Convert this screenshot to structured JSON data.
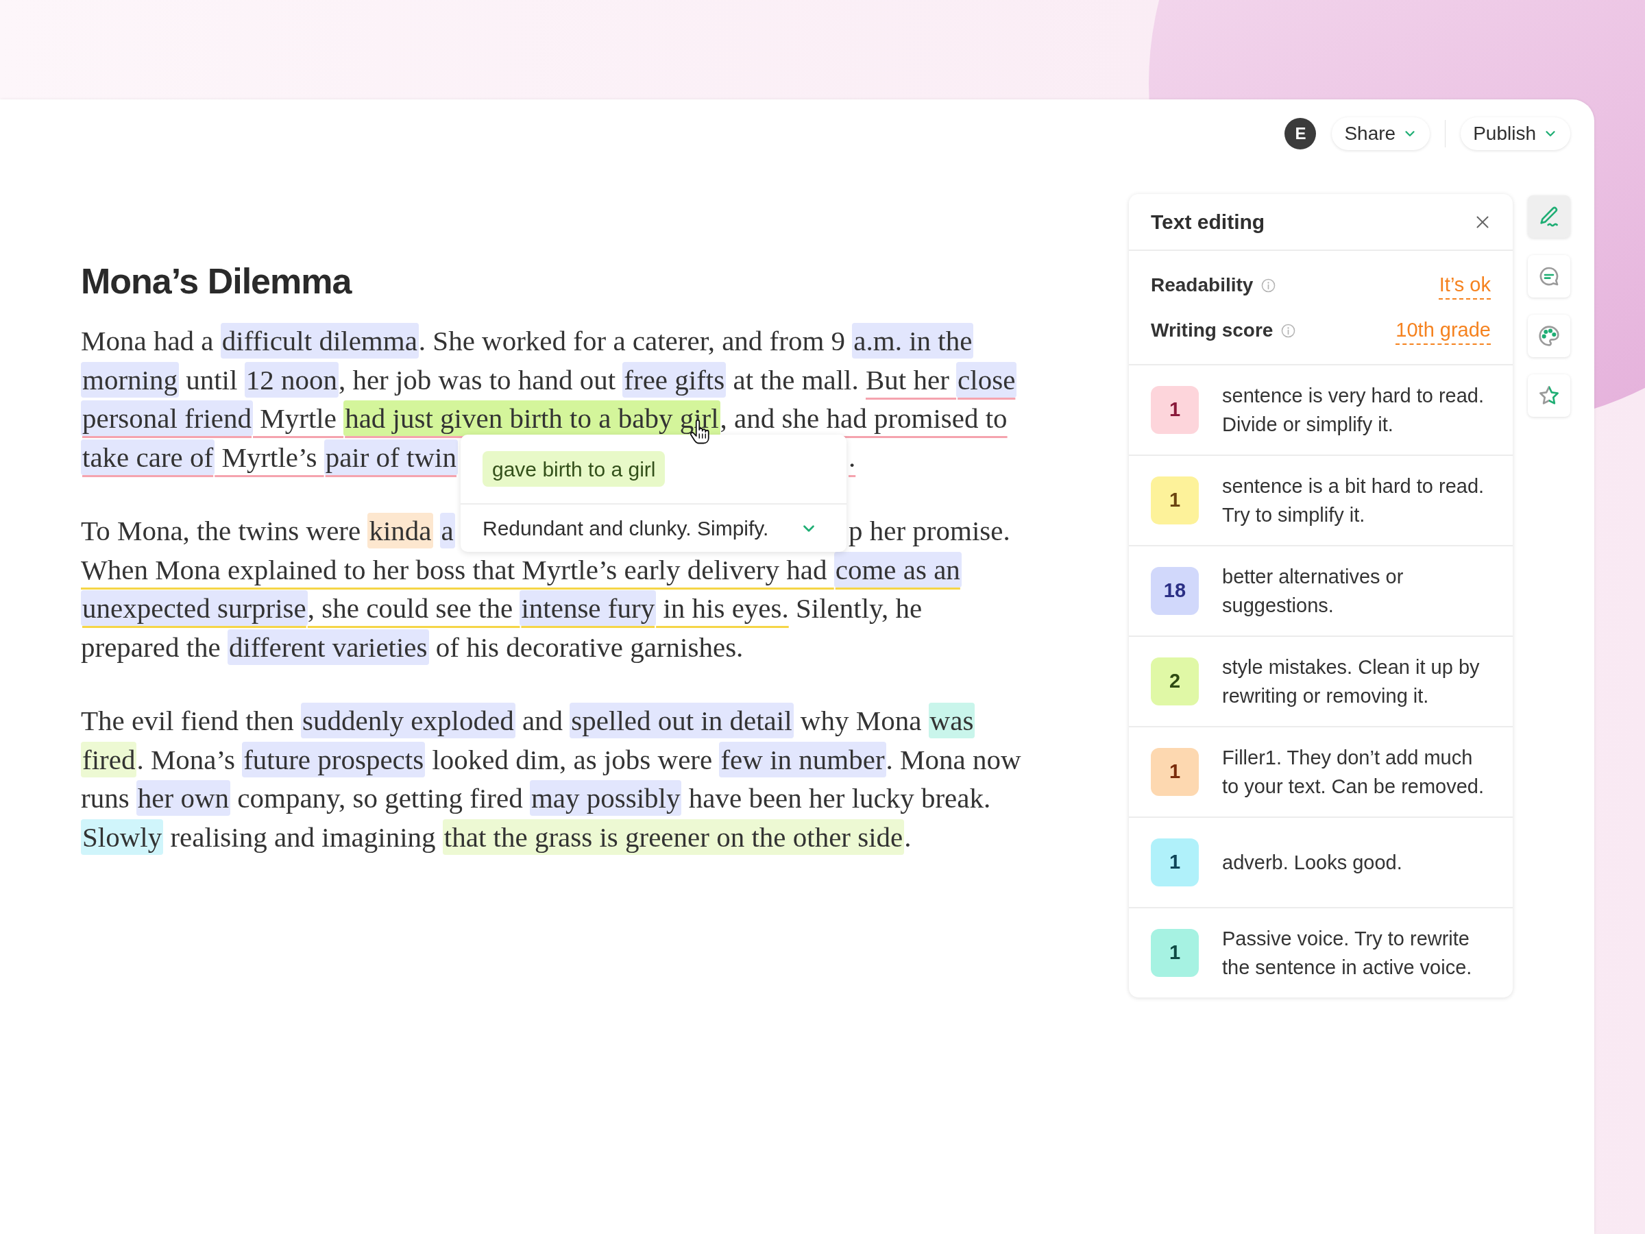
{
  "topbar": {
    "avatar": "E",
    "buttons": [
      {
        "label": "Share"
      },
      {
        "label": "Publish"
      }
    ]
  },
  "document": {
    "title": "Mona’s Dilemma",
    "paragraphs": [
      {
        "lines": [
          {
            "runs": [
              {
                "kind": "plain",
                "segments": [
                  {
                    "text": "Mona had a ",
                    "kind": "plain"
                  },
                  {
                    "text": "difficult dilemma",
                    "kind": "suggestion",
                    "active": false
                  },
                  {
                    "text": ". She worked for a caterer, and from 9 ",
                    "kind": "plain"
                  },
                  {
                    "text": "a.m. in the",
                    "kind": "suggestion",
                    "active": false
                  }
                ]
              }
            ]
          },
          {
            "runs": [
              {
                "kind": "plain",
                "segments": [
                  {
                    "text": "morning",
                    "kind": "suggestion",
                    "active": false
                  },
                  {
                    "text": " until ",
                    "kind": "plain"
                  },
                  {
                    "text": "12 noon",
                    "kind": "suggestion",
                    "active": false
                  },
                  {
                    "text": ", her job was to hand out ",
                    "kind": "plain"
                  },
                  {
                    "text": "free gifts",
                    "kind": "suggestion",
                    "active": false
                  },
                  {
                    "text": " at the mall. ",
                    "kind": "plain"
                  }
                ]
              },
              {
                "kind": "very_hard",
                "segments": [
                  {
                    "text": "But her ",
                    "kind": "plain"
                  },
                  {
                    "text": "close",
                    "kind": "suggestion",
                    "active": false
                  }
                ]
              }
            ]
          },
          {
            "runs": [
              {
                "kind": "very_hard",
                "segments": [
                  {
                    "text": "personal friend",
                    "kind": "suggestion",
                    "active": false
                  },
                  {
                    "text": " Myrtle ",
                    "kind": "plain"
                  },
                  {
                    "text": "had just given birth to a baby girl",
                    "kind": "style",
                    "active": true
                  },
                  {
                    "text": ", and she had promised to",
                    "kind": "plain"
                  }
                ]
              }
            ]
          },
          {
            "runs": [
              {
                "kind": "very_hard",
                "segments": [
                  {
                    "text": "take care of",
                    "kind": "suggestion",
                    "active": false
                  },
                  {
                    "text": " Myrtle’s ",
                    "kind": "plain"
                  },
                  {
                    "text": "pair of twin",
                    "kind": "suggestion",
                    "active": false
                  }
                ]
              }
            ],
            "runs_after_popup": [
              {
                "kind": "very_hard",
                "segments": [
                  {
                    "text": ".",
                    "kind": "plain"
                  }
                ]
              }
            ]
          }
        ]
      },
      {
        "lines": [
          {
            "runs": [
              {
                "kind": "plain",
                "segments": [
                  {
                    "text": "To Mona, the twins were ",
                    "kind": "plain"
                  },
                  {
                    "text": "kinda",
                    "kind": "filler",
                    "active": false
                  },
                  {
                    "text": "a",
                    "kind": "suggestion",
                    "active": false
                  }
                ]
              }
            ],
            "runs_after_popup": [
              {
                "kind": "plain",
                "segments": [
                  {
                    "text": "p her promise.",
                    "kind": "plain"
                  }
                ]
              }
            ]
          },
          {
            "runs": [
              {
                "kind": "hard",
                "segments": [
                  {
                    "text": "When Mona explained to her boss that Myrtle’s early delivery had ",
                    "kind": "plain"
                  },
                  {
                    "text": "come as an",
                    "kind": "suggestion",
                    "active": false
                  }
                ]
              }
            ]
          },
          {
            "runs": [
              {
                "kind": "hard",
                "segments": [
                  {
                    "text": "unexpected surprise",
                    "kind": "suggestion",
                    "active": false
                  },
                  {
                    "text": ", she could see the ",
                    "kind": "plain"
                  },
                  {
                    "text": "intense fury",
                    "kind": "suggestion",
                    "active": false
                  },
                  {
                    "text": " in his eyes.",
                    "kind": "plain"
                  }
                ]
              },
              {
                "kind": "plain",
                "segments": [
                  {
                    "text": " Silently, he",
                    "kind": "plain"
                  }
                ]
              }
            ]
          },
          {
            "runs": [
              {
                "kind": "plain",
                "segments": [
                  {
                    "text": "prepared the ",
                    "kind": "plain"
                  },
                  {
                    "text": "different varieties",
                    "kind": "suggestion",
                    "active": false
                  },
                  {
                    "text": " of his decorative garnishes.",
                    "kind": "plain"
                  }
                ]
              }
            ]
          }
        ]
      },
      {
        "lines": [
          {
            "runs": [
              {
                "kind": "plain",
                "segments": [
                  {
                    "text": "The evil fiend then ",
                    "kind": "plain"
                  },
                  {
                    "text": "suddenly exploded",
                    "kind": "suggestion",
                    "active": false
                  },
                  {
                    "text": " and ",
                    "kind": "plain"
                  },
                  {
                    "text": "spelled out in detail",
                    "kind": "suggestion",
                    "active": false
                  },
                  {
                    "text": " why Mona ",
                    "kind": "plain"
                  },
                  {
                    "text": "was",
                    "kind": "passive",
                    "active": false
                  }
                ]
              }
            ]
          },
          {
            "runs": [
              {
                "kind": "plain",
                "segments": [
                  {
                    "text": "fired",
                    "kind": "style",
                    "active": false
                  },
                  {
                    "text": ". Mona’s ",
                    "kind": "plain"
                  },
                  {
                    "text": "future prospects",
                    "kind": "suggestion",
                    "active": false
                  },
                  {
                    "text": " looked dim, as jobs were ",
                    "kind": "plain"
                  },
                  {
                    "text": "few in number",
                    "kind": "suggestion",
                    "active": false
                  },
                  {
                    "text": ". Mona now",
                    "kind": "plain"
                  }
                ]
              }
            ]
          },
          {
            "runs": [
              {
                "kind": "plain",
                "segments": [
                  {
                    "text": "runs ",
                    "kind": "plain"
                  },
                  {
                    "text": "her own",
                    "kind": "suggestion",
                    "active": false
                  },
                  {
                    "text": " company, so getting fired ",
                    "kind": "plain"
                  },
                  {
                    "text": "may possibly",
                    "kind": "suggestion",
                    "active": false
                  },
                  {
                    "text": " have been her lucky break.",
                    "kind": "plain"
                  }
                ]
              }
            ]
          },
          {
            "runs": [
              {
                "kind": "plain",
                "segments": [
                  {
                    "text": "Slowly",
                    "kind": "adverb",
                    "active": false
                  },
                  {
                    "text": " realising and imagining ",
                    "kind": "plain"
                  },
                  {
                    "text": "that the grass is greener on the other side",
                    "kind": "style",
                    "active": false
                  },
                  {
                    "text": ".",
                    "kind": "plain"
                  }
                ]
              }
            ]
          }
        ]
      }
    ]
  },
  "popup": {
    "replacement": "gave birth to a girl",
    "message": "Redundant and clunky. Simpify.",
    "expanded": false
  },
  "panel": {
    "title": "Text editing",
    "scores": [
      {
        "label": "Readability",
        "value": "It’s ok"
      },
      {
        "label": "Writing score",
        "value": "10th grade"
      }
    ],
    "issues": [
      {
        "kind": "very_hard",
        "count": "1",
        "text": "sentence is very hard to read. Divide or simplify it."
      },
      {
        "kind": "hard",
        "count": "1",
        "text": "sentence is a bit hard to read. Try to simplify it."
      },
      {
        "kind": "suggestion",
        "count": "18",
        "text": "better alternatives or suggestions."
      },
      {
        "kind": "style",
        "count": "2",
        "text": "style mistakes. Clean it up by rewriting or removing it."
      },
      {
        "kind": "filler",
        "count": "1",
        "text": "Filler1. They don’t add much to your text. Can be removed."
      },
      {
        "kind": "adverb",
        "count": "1",
        "text": "adverb. Looks good."
      },
      {
        "kind": "passive",
        "count": "1",
        "text": "Passive voice. Try to rewrite the sentence in active voice."
      }
    ]
  },
  "tools": [
    {
      "kind": "pen",
      "selected": true
    },
    {
      "kind": "comment",
      "selected": false
    },
    {
      "kind": "palette",
      "selected": false
    },
    {
      "kind": "star",
      "selected": false
    }
  ]
}
